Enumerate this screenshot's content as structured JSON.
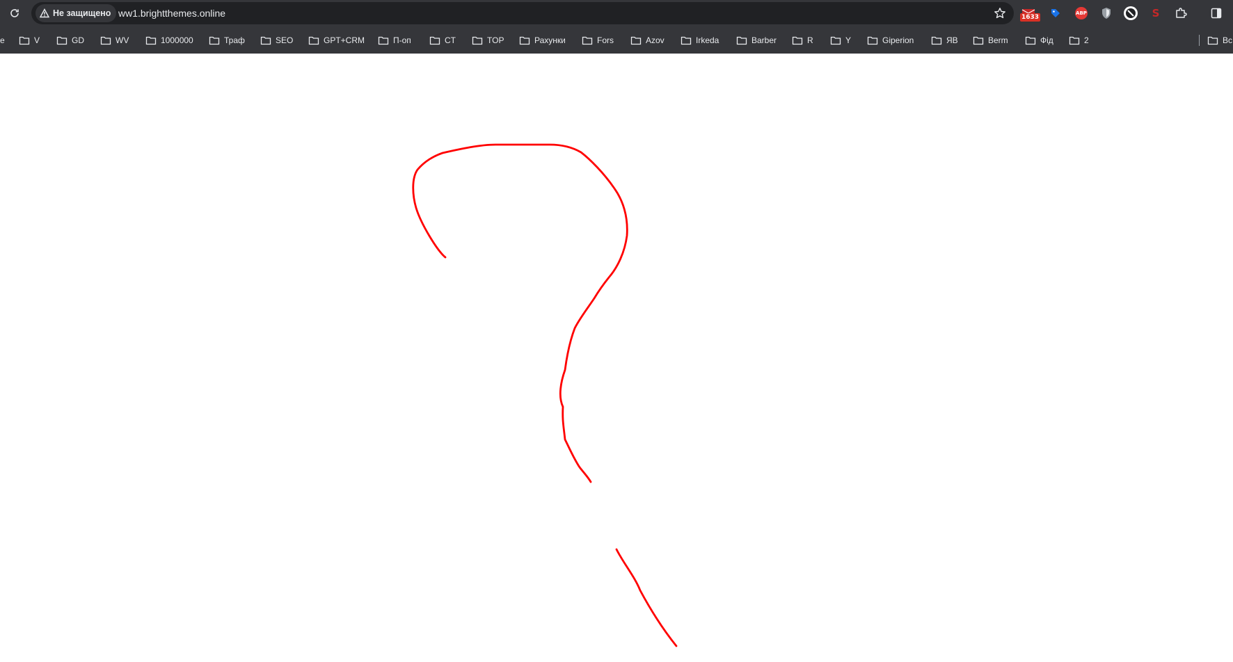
{
  "browser": {
    "security_label": "Не защищено",
    "url": "ww1.brightthemes.online",
    "extension_badge_count": "1633",
    "abp_label": "ABP"
  },
  "bookmarks": [
    {
      "label": "e"
    },
    {
      "label": "V"
    },
    {
      "label": "GD"
    },
    {
      "label": "WV"
    },
    {
      "label": "1000000"
    },
    {
      "label": "Траф"
    },
    {
      "label": "SEO"
    },
    {
      "label": "GPT+CRM"
    },
    {
      "label": "П-оп"
    },
    {
      "label": "CT"
    },
    {
      "label": "TOP"
    },
    {
      "label": "Рахунки"
    },
    {
      "label": "Fors"
    },
    {
      "label": "Azov"
    },
    {
      "label": "Irkeda"
    },
    {
      "label": "Barber"
    },
    {
      "label": "R"
    },
    {
      "label": "Y"
    },
    {
      "label": "Giperion"
    },
    {
      "label": "ЯВ"
    },
    {
      "label": "Berm"
    },
    {
      "label": "Фід"
    },
    {
      "label": "2"
    },
    {
      "label": "Вс"
    }
  ],
  "drawing": {
    "stroke_color": "#ff0000",
    "description_icon": "question-mark-sketch"
  }
}
